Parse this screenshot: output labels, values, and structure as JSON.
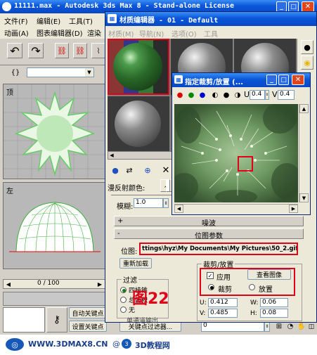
{
  "main_window": {
    "title": "11111.max - Autodesk 3ds Max 8 - Stand-alone License",
    "menu_row1": [
      "文件(F)",
      "编辑(E)",
      "工具(T)"
    ],
    "menu_row2": [
      "动画(A)",
      "图表编辑器(D)",
      "渲染"
    ],
    "viewport_top_label": "顶",
    "viewport_left_label": "左",
    "timeline": "0 / 100",
    "auto_key": "自动关键点",
    "set_key": "设置关键点",
    "key_filter": "关键点过滤器...",
    "frame_value": "0"
  },
  "material_editor": {
    "title": "材质编辑器 - 01 - Default",
    "menu": [
      "材质(M)",
      "导航(N)",
      "选项(O)",
      "工具"
    ],
    "diffuse_label": "漫反射颜色:",
    "blur_label": "模糊:",
    "blur_value": "1.0",
    "noise_rollout": "噪波",
    "bitmap_rollout": "位图参数",
    "bitmap_label": "位图:",
    "bitmap_path": "ttings\\hyz\\My Documents\\My Pictures\\50_2.gif",
    "reload_button": "重新加载",
    "filter_group": "过滤",
    "filter_options": [
      "四棱锥",
      "总面积",
      "无"
    ],
    "crop_group": "裁剪/放置",
    "apply_label": "应用",
    "view_image_button": "查看图像",
    "crop_option": "裁剪",
    "place_option": "放置",
    "u_label": "U:",
    "u_value": "0.412",
    "v_label": "V:",
    "v_value": "0.485",
    "w_label": "W:",
    "w_value": "0.06",
    "h_label": "H:",
    "h_value": "0.08",
    "mono_output": "单通道输出",
    "figure_caption": "图22"
  },
  "crop_window": {
    "title": "指定裁剪/放置 (...",
    "u_label": "U",
    "u_value": "0.4",
    "v_label": "V",
    "v_value": "0.4"
  },
  "watermark": {
    "text1": "WWW.3DMAX8.CN",
    "at": "@",
    "text2": "3D教程网"
  }
}
